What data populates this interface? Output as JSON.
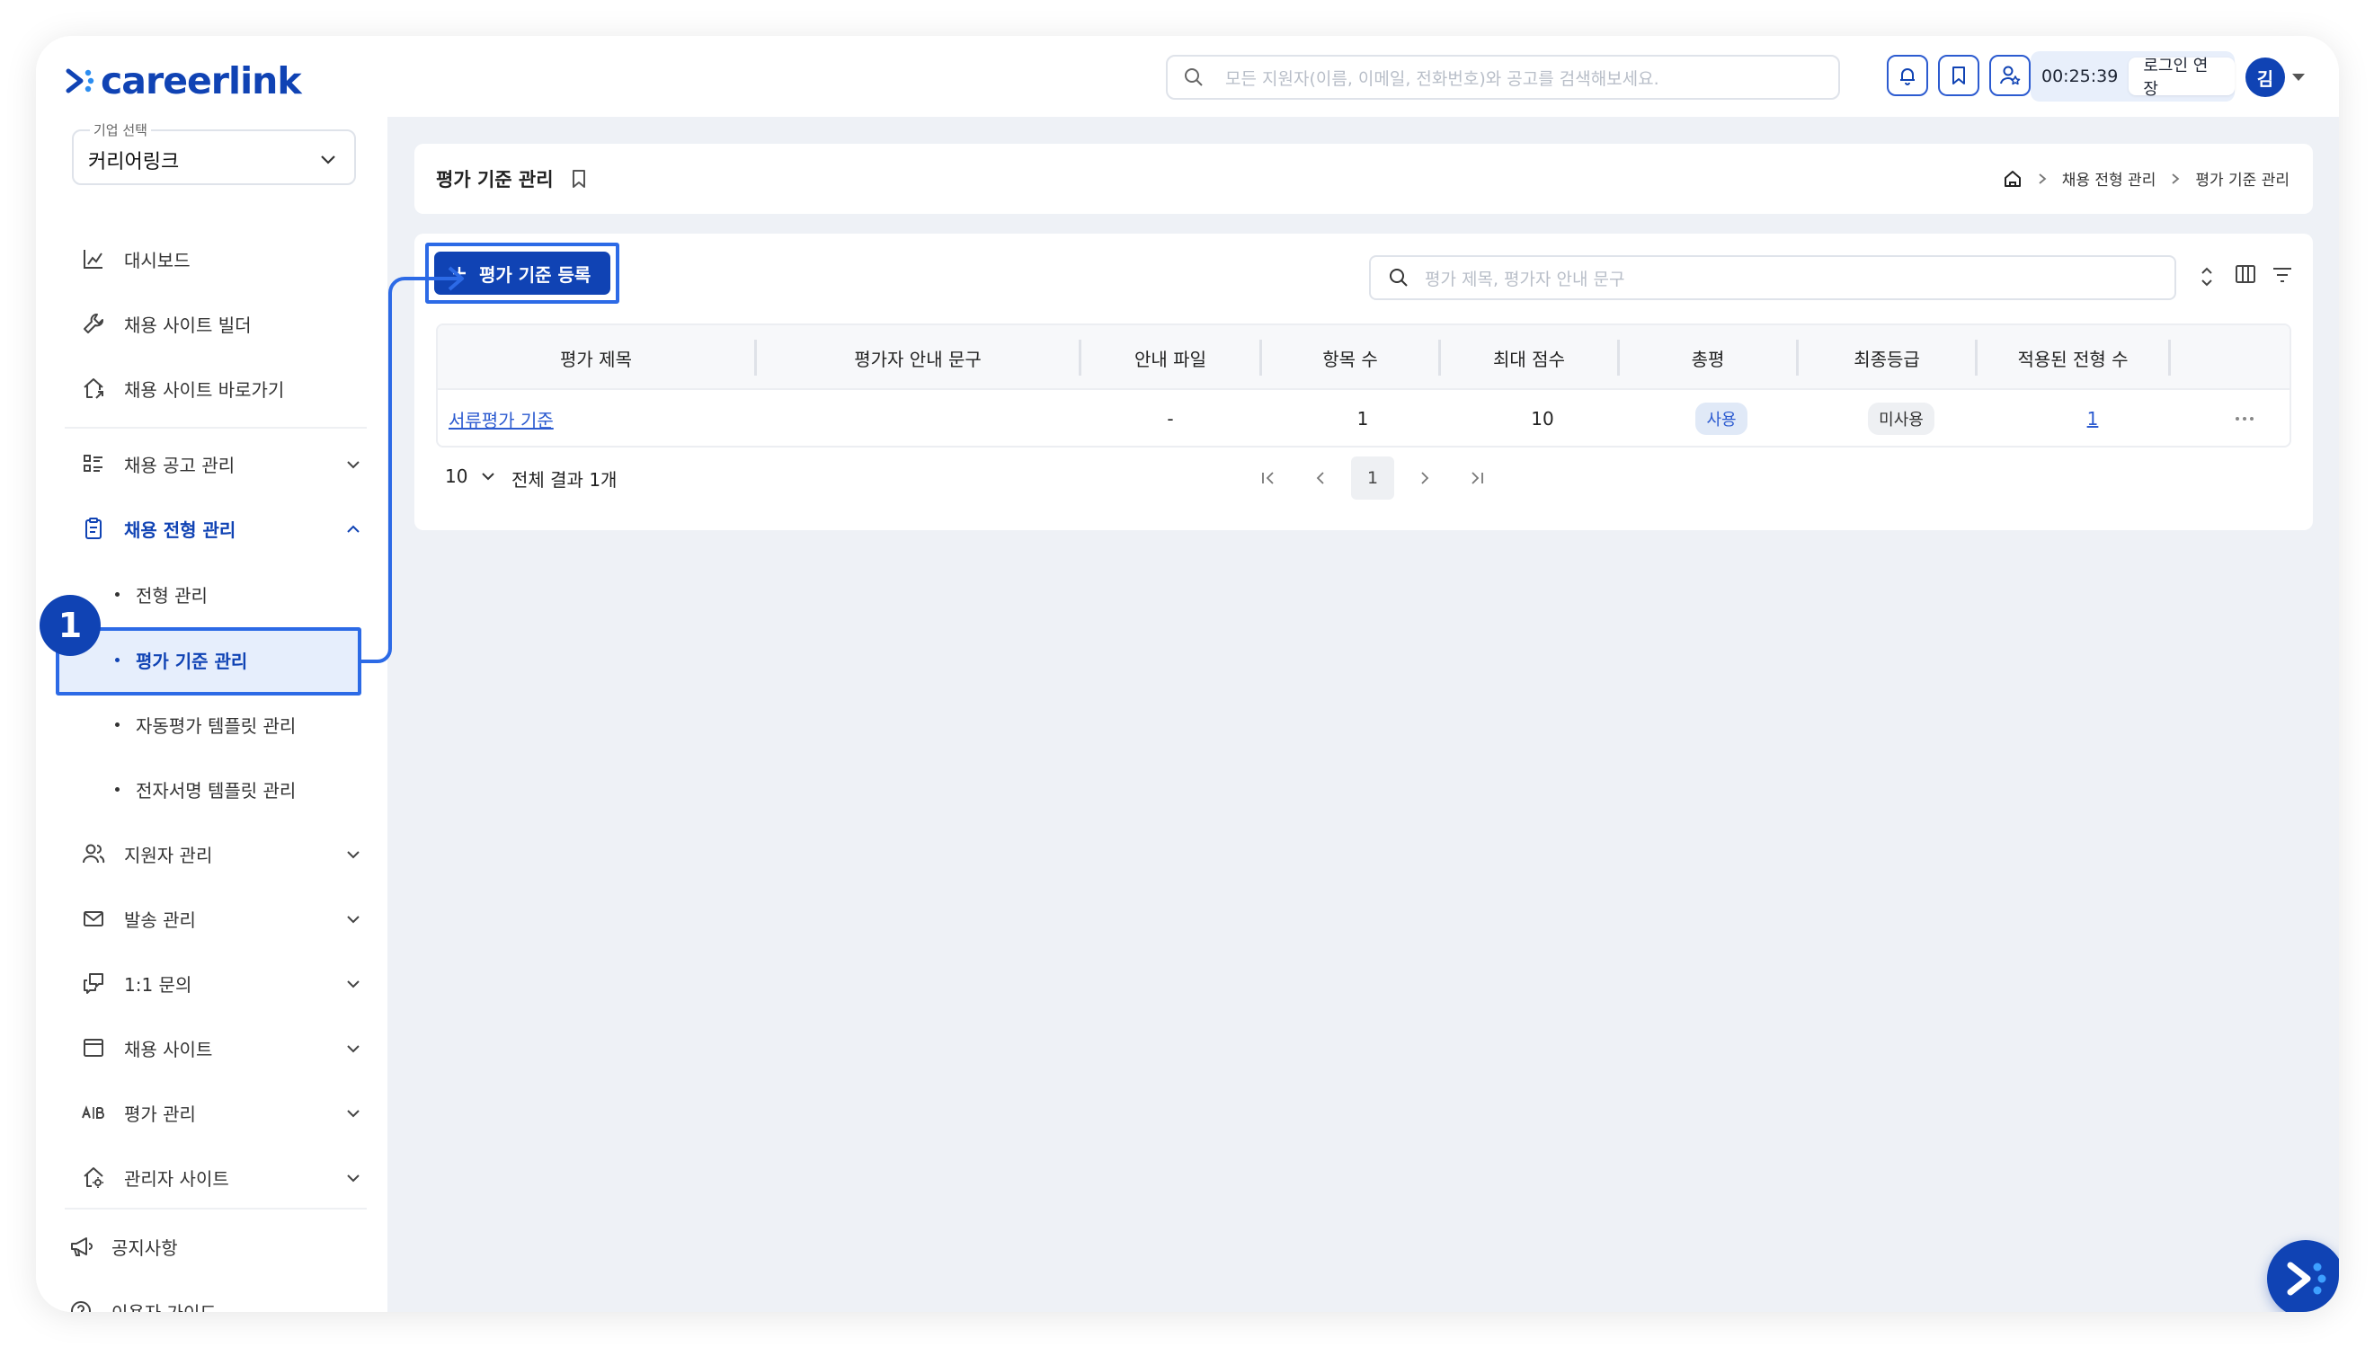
{
  "brand": {
    "name": "careerlink",
    "color": "#1043b4"
  },
  "header": {
    "search_placeholder": "모든 지원자(이름, 이메일, 전화번호)와 공고를 검색해보세요.",
    "icons": [
      "bell-icon",
      "bookmark-icon",
      "user-star-icon"
    ],
    "session_time": "00:25:39",
    "extend_label": "로그인 연장",
    "avatar_initial": "김"
  },
  "sidebar": {
    "company_label": "기업 선택",
    "company_value": "커리어링크",
    "items": [
      {
        "label": "대시보드",
        "icon": "chart-icon"
      },
      {
        "label": "채용 사이트 빌더",
        "icon": "wrench-icon"
      },
      {
        "label": "채용 사이트 바로가기",
        "icon": "home-link-icon"
      },
      {
        "label": "채용 공고 관리",
        "icon": "list-icon"
      },
      {
        "label": "채용 전형 관리",
        "icon": "clipboard-icon"
      },
      {
        "label": "지원자 관리",
        "icon": "users-icon"
      },
      {
        "label": "발송 관리",
        "icon": "mail-icon"
      },
      {
        "label": "1:1 문의",
        "icon": "chat-icon"
      },
      {
        "label": "채용 사이트",
        "icon": "browser-icon"
      },
      {
        "label": "평가 관리",
        "icon": "ab-icon"
      },
      {
        "label": "관리자 사이트",
        "icon": "admin-home-icon"
      }
    ],
    "sub_items": [
      "전형 관리",
      "평가 기준 관리",
      "자동평가 템플릿 관리",
      "전자서명 템플릿 관리"
    ],
    "footer": [
      {
        "label": "공지사항",
        "icon": "megaphone-icon"
      },
      {
        "label": "이용자 가이드",
        "icon": "help-icon"
      }
    ],
    "step_badge": "1"
  },
  "page": {
    "title": "평가 기준 관리",
    "breadcrumb": [
      "채용 전형 관리",
      "평가 기준 관리"
    ],
    "register_label": "평가 기준 등록",
    "search_placeholder": "평가 제목, 평가자 안내 문구"
  },
  "table": {
    "columns": [
      "평가 제목",
      "평가자 안내 문구",
      "안내 파일",
      "항목 수",
      "최대 점수",
      "총평",
      "최종등급",
      "적용된 전형 수"
    ],
    "rows": [
      {
        "title": "서류평가 기준",
        "guide": "",
        "file": "-",
        "items": "1",
        "max_score": "10",
        "summary": "사용",
        "final_grade": "미사용",
        "applied": "1"
      }
    ]
  },
  "pagination": {
    "page_size": "10",
    "total_label": "전체 결과 1개",
    "current_page": "1"
  }
}
